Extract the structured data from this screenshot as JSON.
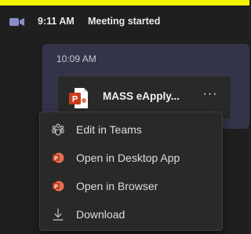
{
  "meeting": {
    "time": "9:11 AM",
    "text": "Meeting started",
    "icon": "video-camera-icon"
  },
  "message": {
    "time": "10:09 AM",
    "file": {
      "name": "MASS eApply...",
      "type_icon": "powerpoint-file-icon",
      "more_label": "···"
    }
  },
  "context_menu": {
    "items": [
      {
        "label": "Edit in Teams",
        "icon": "teams-icon"
      },
      {
        "label": "Open in Desktop App",
        "icon": "powerpoint-icon"
      },
      {
        "label": "Open in Browser",
        "icon": "powerpoint-icon"
      },
      {
        "label": "Download",
        "icon": "download-icon"
      }
    ]
  },
  "colors": {
    "background": "#1f1f1f",
    "bubble": "#333449",
    "highlight": "#f5f500",
    "powerpoint": "#c43e1c",
    "menu_bg": "#292929"
  }
}
